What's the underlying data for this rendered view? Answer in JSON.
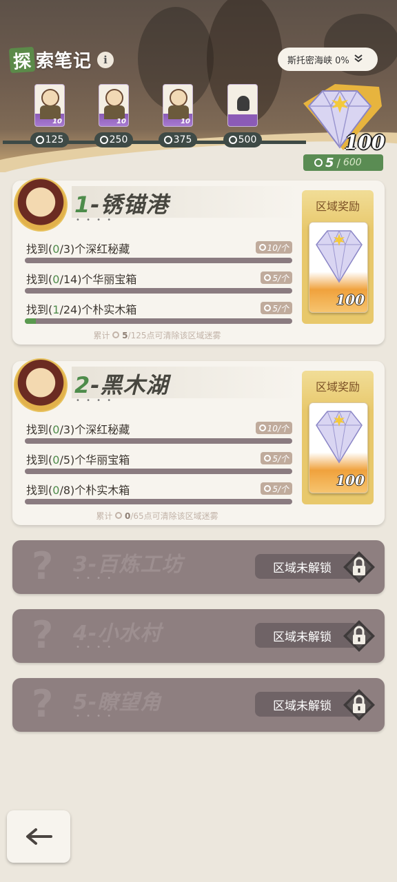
{
  "header": {
    "title_first": "探",
    "title_rest": "索笔记",
    "info_icon": "i",
    "region_select": {
      "label": "斯托密海峡 0%"
    },
    "milestones": [
      {
        "cost": "125",
        "card_num": "10",
        "locked": false
      },
      {
        "cost": "250",
        "card_num": "10",
        "locked": false
      },
      {
        "cost": "375",
        "card_num": "10",
        "locked": false
      },
      {
        "cost": "500",
        "card_num": "",
        "locked": true
      }
    ],
    "gem_reward": "100",
    "progress": {
      "current": "5",
      "separator": "/",
      "max": "600"
    }
  },
  "zones": [
    {
      "index": "1",
      "name": "-锈锚港",
      "dots": "• • • •",
      "tasks": [
        {
          "prefix": "找到(",
          "done": "0",
          "rest": "/3)个深红秘藏",
          "reward": "10/个",
          "fraction": 0.0
        },
        {
          "prefix": "找到(",
          "done": "0",
          "rest": "/14)个华丽宝箱",
          "reward": "5/个",
          "fraction": 0.0
        },
        {
          "prefix": "找到(",
          "done": "1",
          "rest": "/24)个朴实木箱",
          "reward": "5/个",
          "fraction": 0.0417
        }
      ],
      "summary_prefix": "累计",
      "summary_done": "5",
      "summary_rest": "/125点可清除该区域迷雾",
      "reward_title": "区域奖励",
      "reward_count": "100"
    },
    {
      "index": "2",
      "name": "-黑木湖",
      "dots": "• • • •",
      "tasks": [
        {
          "prefix": "找到(",
          "done": "0",
          "rest": "/3)个深红秘藏",
          "reward": "10/个",
          "fraction": 0.0
        },
        {
          "prefix": "找到(",
          "done": "0",
          "rest": "/5)个华丽宝箱",
          "reward": "5/个",
          "fraction": 0.0
        },
        {
          "prefix": "找到(",
          "done": "0",
          "rest": "/8)个朴实木箱",
          "reward": "5/个",
          "fraction": 0.0
        }
      ],
      "summary_prefix": "累计",
      "summary_done": "0",
      "summary_rest": "/65点可清除该区域迷雾",
      "reward_title": "区域奖励",
      "reward_count": "100"
    }
  ],
  "locked_zones": [
    {
      "name": "3-百炼工坊",
      "dots": "• • • •",
      "status": "区域未解锁"
    },
    {
      "name": "4-小水村",
      "dots": "• • • •",
      "status": "区域未解锁"
    },
    {
      "name": "5-瞭望角",
      "dots": "• • • •",
      "status": "区域未解锁"
    }
  ],
  "colors": {
    "accent_green": "#4e8c4b",
    "locked_card": "#8e7f80",
    "reward_gold": "#e8c86b"
  },
  "icons": [
    "info-icon",
    "chevron-down-icon",
    "stopwatch-icon",
    "diamond-gem-icon",
    "lock-icon",
    "back-arrow-icon",
    "question-mark-icon"
  ]
}
